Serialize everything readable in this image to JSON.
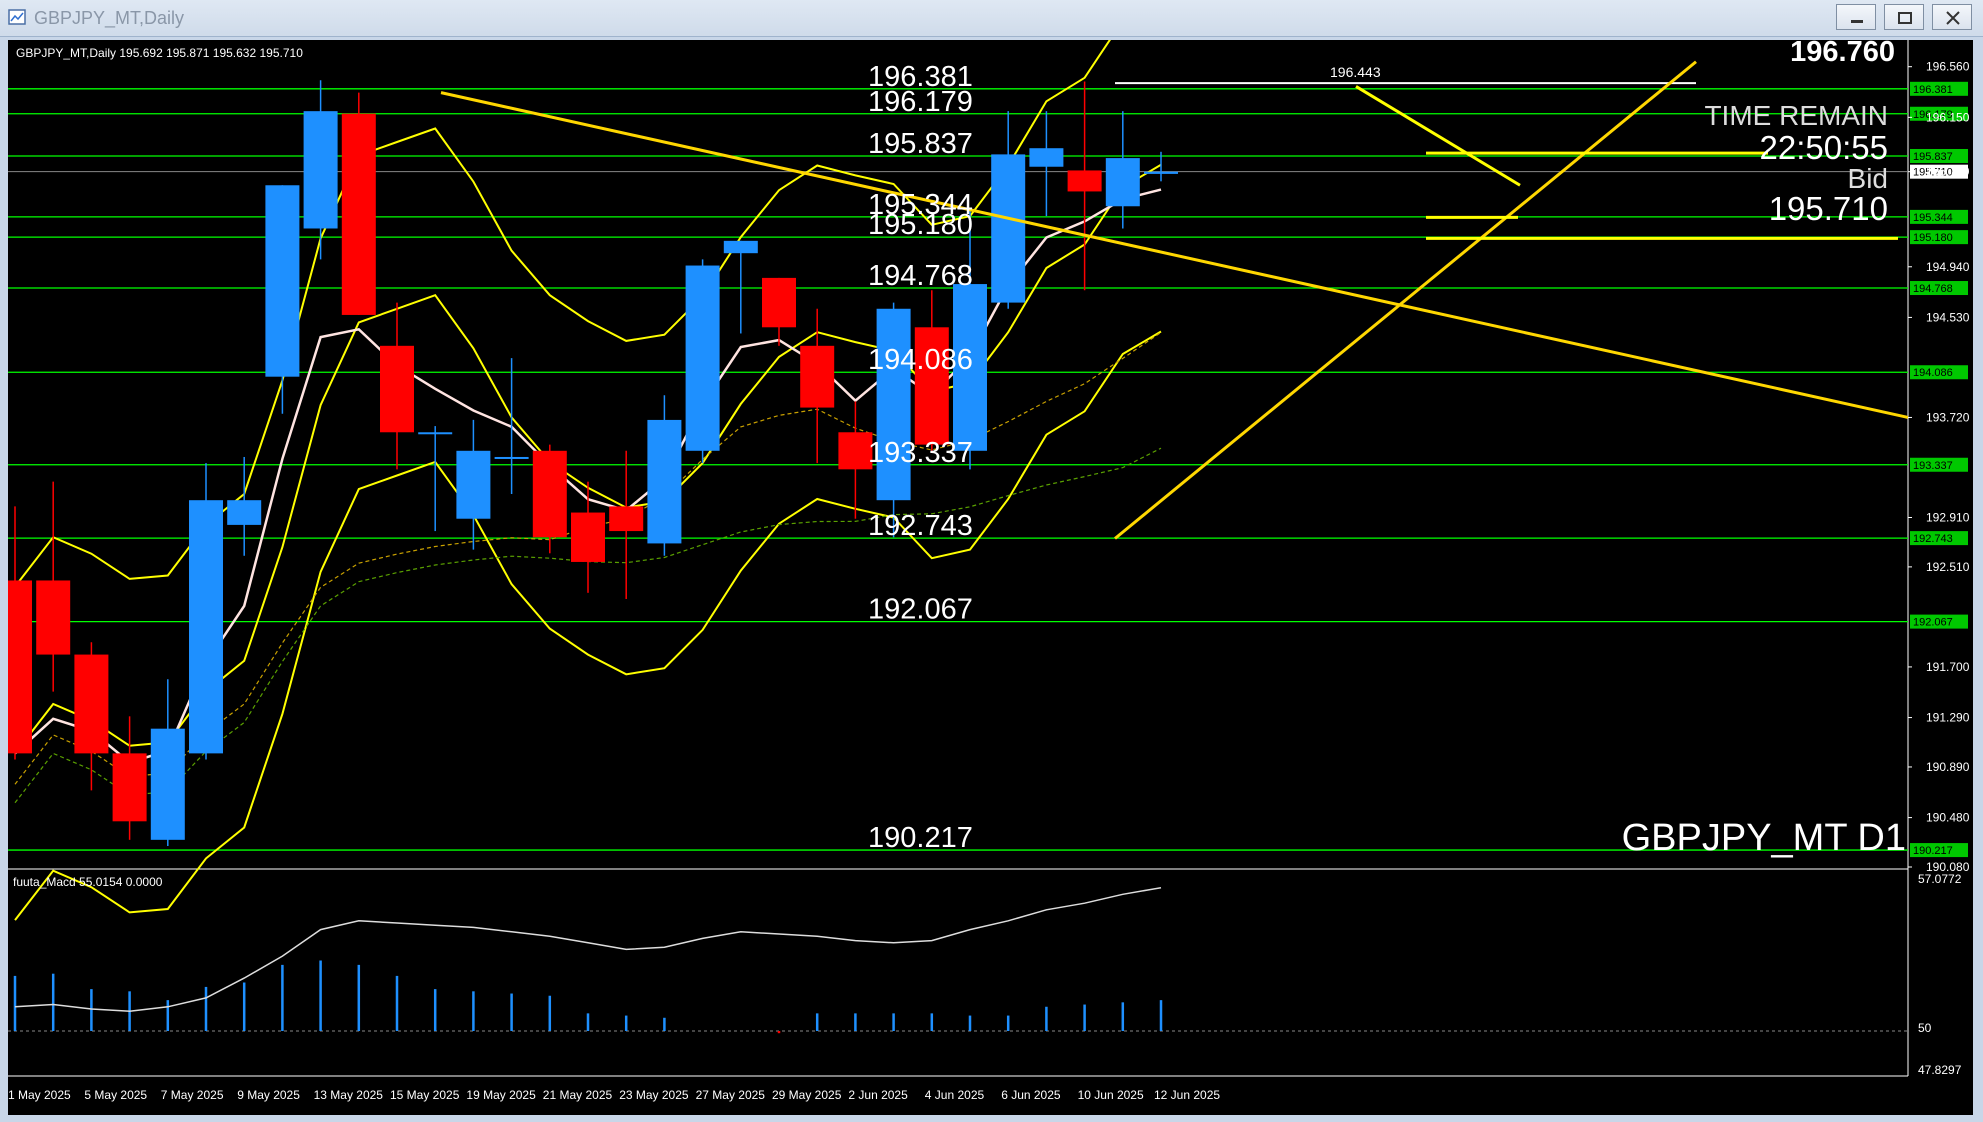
{
  "window": {
    "title": "GBPJPY_MT,Daily"
  },
  "header": {
    "info": "GBPJPY_MT,Daily  195.692 195.871 195.632 195.710"
  },
  "watermark": "GBPJPY_MT D1",
  "countdown": {
    "price": "196.760",
    "label": "TIME REMAIN",
    "time": "22:50:55",
    "bid_label": "Bid",
    "bid": "195.710"
  },
  "macd": {
    "label": "fuuta_Macd 55.0154  0.0000",
    "axis": [
      "57.0772",
      "50",
      "47.8297"
    ],
    "zero_value": 50
  },
  "colors": {
    "bull": "#1e90ff",
    "bear": "#ff0000",
    "level": "#00ff00",
    "trend": "#ffd700",
    "bands": "#ffff00",
    "ma": "#ffe4e1"
  },
  "chart_data": {
    "type": "candlestick",
    "symbol": "GBPJPY_MT",
    "timeframe": "Daily",
    "ylim": [
      190.08,
      196.76
    ],
    "price_axis": [
      "196.560",
      "196.150",
      "195.710",
      "194.940",
      "194.530",
      "193.720",
      "192.910",
      "192.510",
      "191.700",
      "191.290",
      "190.890",
      "190.480",
      "190.080"
    ],
    "date_labels": [
      {
        "i": 0,
        "label": "1 May 2025"
      },
      {
        "i": 2,
        "label": "5 May 2025"
      },
      {
        "i": 4,
        "label": "7 May 2025"
      },
      {
        "i": 6,
        "label": "9 May 2025"
      },
      {
        "i": 8,
        "label": "13 May 2025"
      },
      {
        "i": 10,
        "label": "15 May 2025"
      },
      {
        "i": 12,
        "label": "19 May 2025"
      },
      {
        "i": 14,
        "label": "21 May 2025"
      },
      {
        "i": 16,
        "label": "23 May 2025"
      },
      {
        "i": 18,
        "label": "27 May 2025"
      },
      {
        "i": 20,
        "label": "29 May 2025"
      },
      {
        "i": 22,
        "label": "2 Jun 2025"
      },
      {
        "i": 24,
        "label": "4 Jun 2025"
      },
      {
        "i": 26,
        "label": "6 Jun 2025"
      },
      {
        "i": 28,
        "label": "10 Jun 2025"
      },
      {
        "i": 30,
        "label": "12 Jun 2025"
      }
    ],
    "levels": [
      {
        "value": 196.381,
        "label": "196.381"
      },
      {
        "value": 196.179,
        "label": "196.179"
      },
      {
        "value": 195.837,
        "label": "195.837"
      },
      {
        "value": 195.344,
        "label": "195.344"
      },
      {
        "value": 195.18,
        "label": "195.180"
      },
      {
        "value": 194.768,
        "label": "194.768"
      },
      {
        "value": 194.086,
        "label": "194.086"
      },
      {
        "value": 193.337,
        "label": "193.337"
      },
      {
        "value": 192.743,
        "label": "192.743"
      },
      {
        "value": 192.067,
        "label": "192.067"
      },
      {
        "value": 190.217,
        "label": "190.217"
      }
    ],
    "high_marker": {
      "value": 196.443,
      "label": "196.443"
    },
    "candles": [
      {
        "o": 192.4,
        "h": 193.0,
        "l": 190.95,
        "c": 191.0
      },
      {
        "o": 192.4,
        "h": 193.2,
        "l": 191.5,
        "c": 191.8
      },
      {
        "o": 191.8,
        "h": 191.9,
        "l": 190.7,
        "c": 191.0
      },
      {
        "o": 191.0,
        "h": 191.3,
        "l": 190.3,
        "c": 190.45
      },
      {
        "o": 190.3,
        "h": 191.6,
        "l": 190.25,
        "c": 191.2
      },
      {
        "o": 191.0,
        "h": 193.35,
        "l": 190.95,
        "c": 193.05
      },
      {
        "o": 192.85,
        "h": 193.4,
        "l": 192.6,
        "c": 193.05
      },
      {
        "o": 194.05,
        "h": 195.6,
        "l": 193.75,
        "c": 195.6
      },
      {
        "o": 195.25,
        "h": 196.45,
        "l": 195.0,
        "c": 196.2
      },
      {
        "o": 196.18,
        "h": 196.35,
        "l": 194.55,
        "c": 194.55
      },
      {
        "o": 194.3,
        "h": 194.65,
        "l": 193.3,
        "c": 193.6
      },
      {
        "o": 193.6,
        "h": 193.65,
        "l": 192.8,
        "c": 193.6
      },
      {
        "o": 192.9,
        "h": 193.7,
        "l": 192.65,
        "c": 193.45
      },
      {
        "o": 193.4,
        "h": 194.2,
        "l": 193.1,
        "c": 193.4
      },
      {
        "o": 193.45,
        "h": 193.5,
        "l": 192.62,
        "c": 192.75
      },
      {
        "o": 192.95,
        "h": 193.2,
        "l": 192.3,
        "c": 192.55
      },
      {
        "o": 193.0,
        "h": 193.45,
        "l": 192.25,
        "c": 192.8
      },
      {
        "o": 192.7,
        "h": 193.9,
        "l": 192.6,
        "c": 193.7
      },
      {
        "o": 193.45,
        "h": 195.0,
        "l": 193.35,
        "c": 194.95
      },
      {
        "o": 195.05,
        "h": 195.15,
        "l": 194.4,
        "c": 195.15
      },
      {
        "o": 194.85,
        "h": 194.85,
        "l": 194.3,
        "c": 194.45
      },
      {
        "o": 194.3,
        "h": 194.6,
        "l": 193.35,
        "c": 193.8
      },
      {
        "o": 193.6,
        "h": 193.85,
        "l": 192.9,
        "c": 193.3
      },
      {
        "o": 193.05,
        "h": 194.65,
        "l": 192.75,
        "c": 194.6
      },
      {
        "o": 194.45,
        "h": 194.75,
        "l": 193.45,
        "c": 193.5
      },
      {
        "o": 193.45,
        "h": 195.4,
        "l": 193.3,
        "c": 194.8
      },
      {
        "o": 194.65,
        "h": 196.2,
        "l": 194.6,
        "c": 195.85
      },
      {
        "o": 195.75,
        "h": 196.2,
        "l": 195.35,
        "c": 195.9
      },
      {
        "o": 195.72,
        "h": 196.44,
        "l": 194.75,
        "c": 195.55
      },
      {
        "o": 195.43,
        "h": 196.2,
        "l": 195.25,
        "c": 195.82
      },
      {
        "o": 195.692,
        "h": 195.871,
        "l": 195.632,
        "c": 195.71
      }
    ],
    "macd_hist": [
      52.5,
      52.6,
      51.9,
      51.8,
      51.4,
      52.0,
      52.2,
      53.0,
      53.2,
      53.0,
      52.5,
      51.9,
      51.8,
      51.7,
      51.6,
      50.8,
      50.7,
      50.6,
      50.0,
      50.0,
      49.9,
      50.8,
      50.8,
      50.8,
      50.8,
      50.7,
      50.7,
      51.1,
      51.2,
      51.3,
      51.4
    ],
    "macd_signal": [
      51.1,
      51.2,
      51.0,
      50.9,
      51.1,
      51.5,
      52.4,
      53.4,
      54.6,
      55.0,
      54.9,
      54.8,
      54.7,
      54.5,
      54.3,
      54.0,
      53.7,
      53.8,
      54.2,
      54.5,
      54.4,
      54.3,
      54.1,
      54.0,
      54.1,
      54.6,
      55.0,
      55.5,
      55.8,
      56.2,
      56.5
    ]
  }
}
